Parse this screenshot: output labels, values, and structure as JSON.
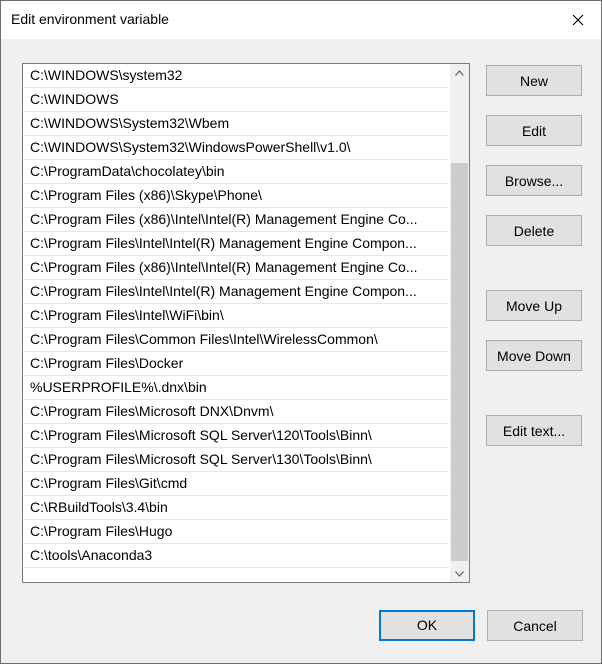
{
  "window": {
    "title": "Edit environment variable",
    "close_icon": "close-icon"
  },
  "paths": [
    "C:\\WINDOWS\\system32",
    "C:\\WINDOWS",
    "C:\\WINDOWS\\System32\\Wbem",
    "C:\\WINDOWS\\System32\\WindowsPowerShell\\v1.0\\",
    "C:\\ProgramData\\chocolatey\\bin",
    "C:\\Program Files (x86)\\Skype\\Phone\\",
    "C:\\Program Files (x86)\\Intel\\Intel(R) Management Engine Co...",
    "C:\\Program Files\\Intel\\Intel(R) Management Engine Compon...",
    "C:\\Program Files (x86)\\Intel\\Intel(R) Management Engine Co...",
    "C:\\Program Files\\Intel\\Intel(R) Management Engine Compon...",
    "C:\\Program Files\\Intel\\WiFi\\bin\\",
    "C:\\Program Files\\Common Files\\Intel\\WirelessCommon\\",
    "C:\\Program Files\\Docker",
    "%USERPROFILE%\\.dnx\\bin",
    "C:\\Program Files\\Microsoft DNX\\Dnvm\\",
    "C:\\Program Files\\Microsoft SQL Server\\120\\Tools\\Binn\\",
    "C:\\Program Files\\Microsoft SQL Server\\130\\Tools\\Binn\\",
    "C:\\Program Files\\Git\\cmd",
    "C:\\RBuildTools\\3.4\\bin",
    "C:\\Program Files\\Hugo",
    "C:\\tools\\Anaconda3"
  ],
  "buttons": {
    "new": "New",
    "edit": "Edit",
    "browse": "Browse...",
    "delete": "Delete",
    "move_up": "Move Up",
    "move_down": "Move Down",
    "edit_text": "Edit text...",
    "ok": "OK",
    "cancel": "Cancel"
  },
  "colors": {
    "accent": "#0078d7",
    "button_face": "#e1e1e1",
    "dialog_bg": "#f0f0f0"
  }
}
